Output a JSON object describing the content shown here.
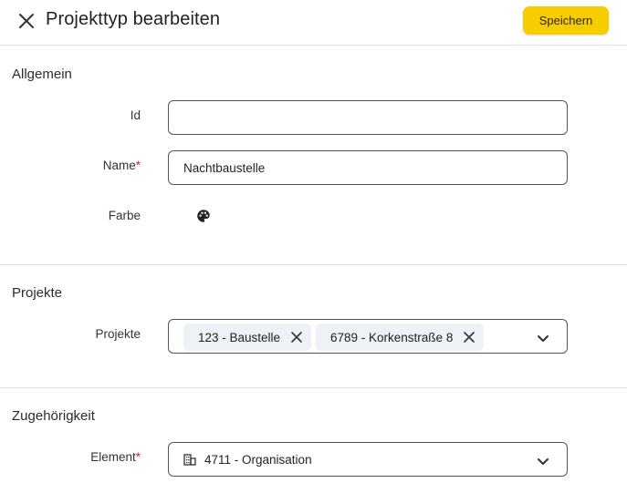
{
  "header": {
    "title": "Projekttyp bearbeiten",
    "save_label": "Speichern",
    "close_icon": "close-icon"
  },
  "sections": {
    "allgemein": {
      "title": "Allgemein",
      "id_label": "Id",
      "id_value": "",
      "name_label": "Name",
      "name_required": "*",
      "name_value": "Nachtbaustelle",
      "farbe_label": "Farbe",
      "farbe_icon": "palette-icon"
    },
    "projekte": {
      "title": "Projekte",
      "projekte_label": "Projekte",
      "chips": [
        "123 - Baustelle",
        "6789 - Korkenstraße 8"
      ],
      "dropdown_icon": "chevron-down-icon"
    },
    "zugehoerigkeit": {
      "title": "Zugehörigkeit",
      "element_label": "Element",
      "element_required": "*",
      "element_value": "4711 - Organisation",
      "element_icon": "building-icon",
      "dropdown_icon": "chevron-down-icon"
    }
  },
  "colors": {
    "accent": "#f7cc00",
    "required": "#c62828",
    "chip_bg": "#eef1f6",
    "divider": "#e3e3e3"
  }
}
